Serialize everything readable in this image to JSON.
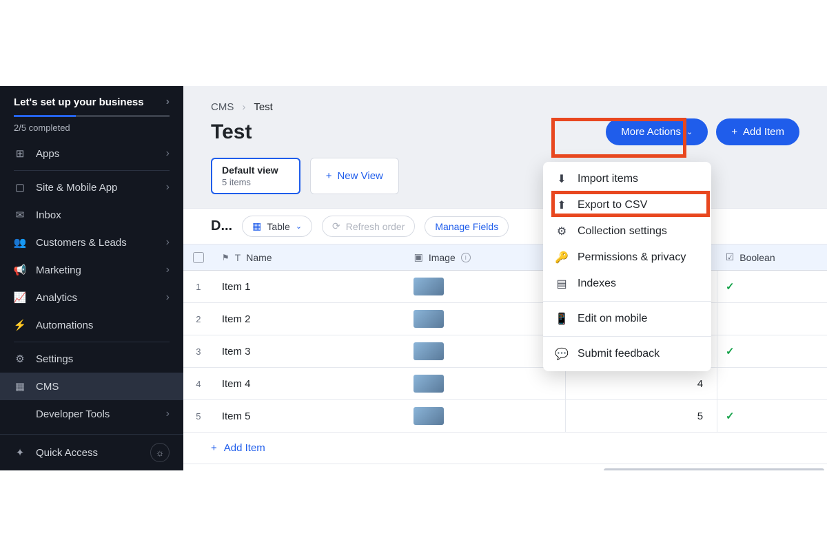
{
  "sidebar": {
    "setup_title": "Let's set up your business",
    "setup_progress": "2/5 completed",
    "items": [
      {
        "icon": "apps",
        "label": "Apps",
        "chev": true
      },
      {
        "icon": "site",
        "label": "Site & Mobile App",
        "chev": true
      },
      {
        "icon": "inbox",
        "label": "Inbox",
        "chev": false
      },
      {
        "icon": "customers",
        "label": "Customers & Leads",
        "chev": true
      },
      {
        "icon": "marketing",
        "label": "Marketing",
        "chev": true
      },
      {
        "icon": "analytics",
        "label": "Analytics",
        "chev": true
      },
      {
        "icon": "automations",
        "label": "Automations",
        "chev": false
      },
      {
        "icon": "settings",
        "label": "Settings",
        "chev": false
      },
      {
        "icon": "cms",
        "label": "CMS",
        "chev": false,
        "active": true
      },
      {
        "icon": "dev",
        "label": "Developer Tools",
        "chev": true
      }
    ],
    "quick": "Quick Access"
  },
  "breadcrumb": {
    "root": "CMS",
    "current": "Test"
  },
  "page_title": "Test",
  "buttons": {
    "more": "More Actions",
    "add": "Add Item"
  },
  "view": {
    "name": "Default view",
    "count": "5 items",
    "new": "New View"
  },
  "toolbar": {
    "trunc": "D...",
    "table": "Table",
    "refresh": "Refresh order",
    "manage": "Manage Fields"
  },
  "columns": {
    "name": "Name",
    "image": "Image",
    "bool": "Boolean"
  },
  "rows": [
    {
      "n": "1",
      "name": "Item 1",
      "int": "",
      "bool": true
    },
    {
      "n": "2",
      "name": "Item 2",
      "int": "",
      "bool": false
    },
    {
      "n": "3",
      "name": "Item 3",
      "int": "",
      "bool": true
    },
    {
      "n": "4",
      "name": "Item 4",
      "int": "4",
      "bool": false
    },
    {
      "n": "5",
      "name": "Item 5",
      "int": "5",
      "bool": true
    }
  ],
  "add_row": "Add Item",
  "dropdown": [
    {
      "icon": "download",
      "label": "Import items"
    },
    {
      "icon": "upload",
      "label": "Export to CSV"
    },
    {
      "icon": "gear",
      "label": "Collection settings"
    },
    {
      "icon": "key",
      "label": "Permissions & privacy"
    },
    {
      "icon": "index",
      "label": "Indexes"
    },
    {
      "sep": true
    },
    {
      "icon": "mobile",
      "label": "Edit on mobile"
    },
    {
      "sep": true
    },
    {
      "icon": "chat",
      "label": "Submit feedback"
    }
  ]
}
